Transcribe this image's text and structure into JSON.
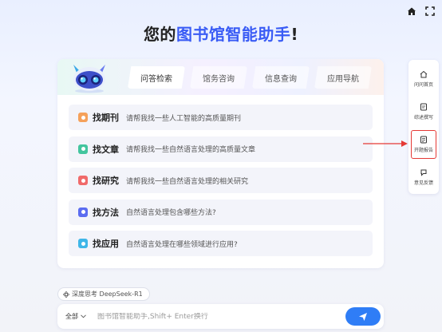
{
  "title": {
    "prefix": "您的",
    "highlight": "图书馆智能助手",
    "suffix": "!"
  },
  "tabs": [
    {
      "label": "问答检索",
      "active": true
    },
    {
      "label": "馆务咨询",
      "active": false
    },
    {
      "label": "信息查询",
      "active": false
    },
    {
      "label": "应用导航",
      "active": false
    }
  ],
  "items": [
    {
      "title": "找期刊",
      "desc": "请帮我找一些人工智能的高质量期刊",
      "color": "#f5a15a"
    },
    {
      "title": "找文章",
      "desc": "请帮我找一些自然语言处理的高质量文章",
      "color": "#43c59e"
    },
    {
      "title": "找研究",
      "desc": "请帮我找一些自然语言处理的相关研究",
      "color": "#f06a6a"
    },
    {
      "title": "找方法",
      "desc": "自然语言处理包含哪些方法?",
      "color": "#5b6cf0"
    },
    {
      "title": "找应用",
      "desc": "自然语言处理在哪些领域进行应用?",
      "color": "#3fb6e8"
    }
  ],
  "sidebar": [
    {
      "label": "问问首页",
      "icon": "home-icon"
    },
    {
      "label": "综述撰写",
      "icon": "document-edit-icon"
    },
    {
      "label": "开题报告",
      "icon": "report-icon",
      "active": true
    },
    {
      "label": "意见反馈",
      "icon": "feedback-icon"
    }
  ],
  "chip": {
    "label": "深度思考 DeepSeek-R1"
  },
  "input": {
    "scope": "全部",
    "placeholder": "图书馆智能助手,Shift+ Enter换行"
  },
  "colors": {
    "accent": "#3a5cf5",
    "send": "#2f7df6",
    "highlight_border": "#e53935"
  }
}
